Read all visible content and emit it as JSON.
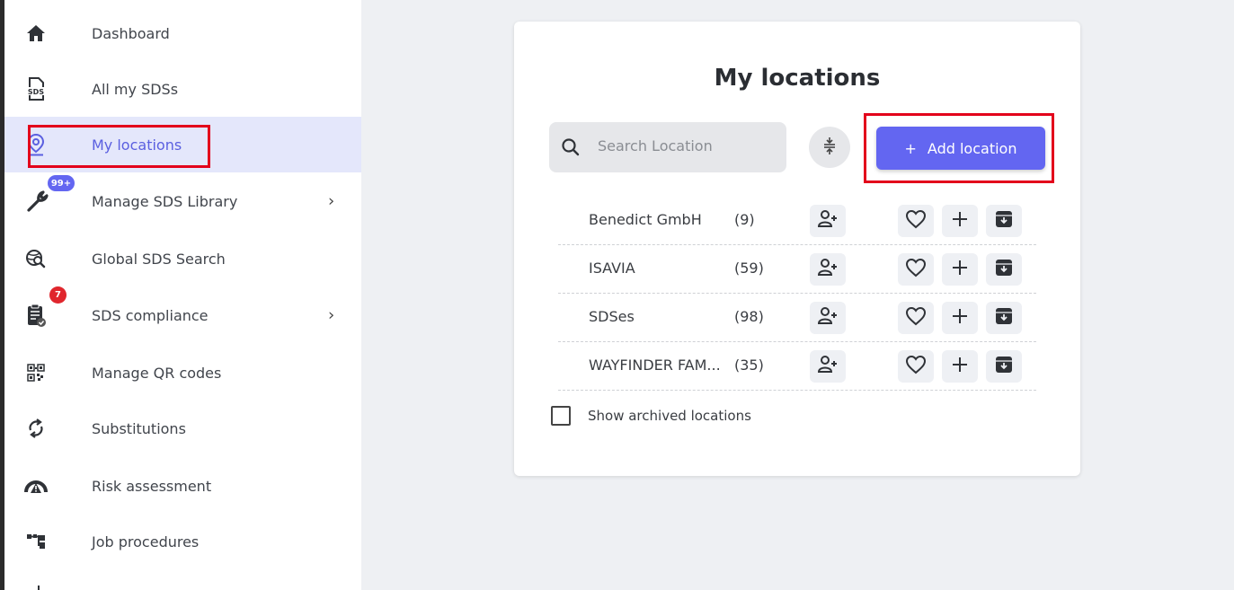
{
  "sidebar": {
    "items": [
      {
        "label": "Dashboard",
        "icon": "home-icon"
      },
      {
        "label": "All my SDSs",
        "icon": "sds-document-icon",
        "icon_text": "SDS"
      },
      {
        "label": "My locations",
        "icon": "location-pin-icon",
        "active": true
      },
      {
        "label": "Manage SDS Library",
        "icon": "wrench-icon",
        "badge": "99+",
        "chevron": "›"
      },
      {
        "label": "Global SDS Search",
        "icon": "global-search-icon"
      },
      {
        "label": "SDS compliance",
        "icon": "clipboard-check-icon",
        "badge": "7",
        "chevron": "›"
      },
      {
        "label": "Manage QR codes",
        "icon": "qr-code-icon"
      },
      {
        "label": "Substitutions",
        "icon": "swap-arrows-icon"
      },
      {
        "label": "Risk assessment",
        "icon": "risk-gauge-icon"
      },
      {
        "label": "Job procedures",
        "icon": "hierarchy-icon"
      }
    ]
  },
  "main": {
    "title": "My locations",
    "search": {
      "placeholder": "Search Location",
      "value": ""
    },
    "add_button": {
      "label": "Add location",
      "icon": "plus-icon"
    },
    "locations": [
      {
        "name": "Benedict GmbH",
        "count": "(9)"
      },
      {
        "name": "ISAVIA",
        "count": "(59)"
      },
      {
        "name": "SDSes",
        "count": "(98)"
      },
      {
        "name": "WAYFINDER FAM...",
        "count": "(35)"
      }
    ],
    "show_archived": {
      "label": "Show archived locations",
      "checked": false
    }
  },
  "colors": {
    "accent": "#6366f1",
    "highlight": "#e3001b",
    "badge_red": "#e0262d",
    "active_bg": "#e4e7fb"
  }
}
